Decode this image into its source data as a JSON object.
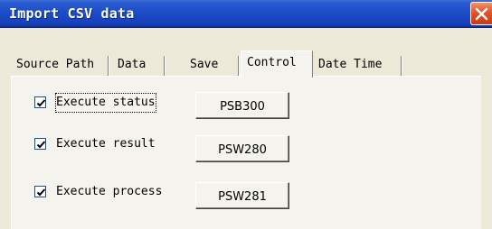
{
  "window": {
    "title": "Import CSV data",
    "close_icon": "close-icon"
  },
  "tabs": [
    {
      "label": "Source Path",
      "active": false
    },
    {
      "label": "Data",
      "active": false
    },
    {
      "label": "Save",
      "active": false
    },
    {
      "label": "Control",
      "active": true
    },
    {
      "label": "Date Time",
      "active": false
    }
  ],
  "controls": [
    {
      "checkbox_checked": true,
      "label": "Execute status",
      "button_label": "PSB300"
    },
    {
      "checkbox_checked": true,
      "label": "Execute result",
      "button_label": "PSW280"
    },
    {
      "checkbox_checked": true,
      "label": "Execute process",
      "button_label": "PSW281"
    }
  ]
}
